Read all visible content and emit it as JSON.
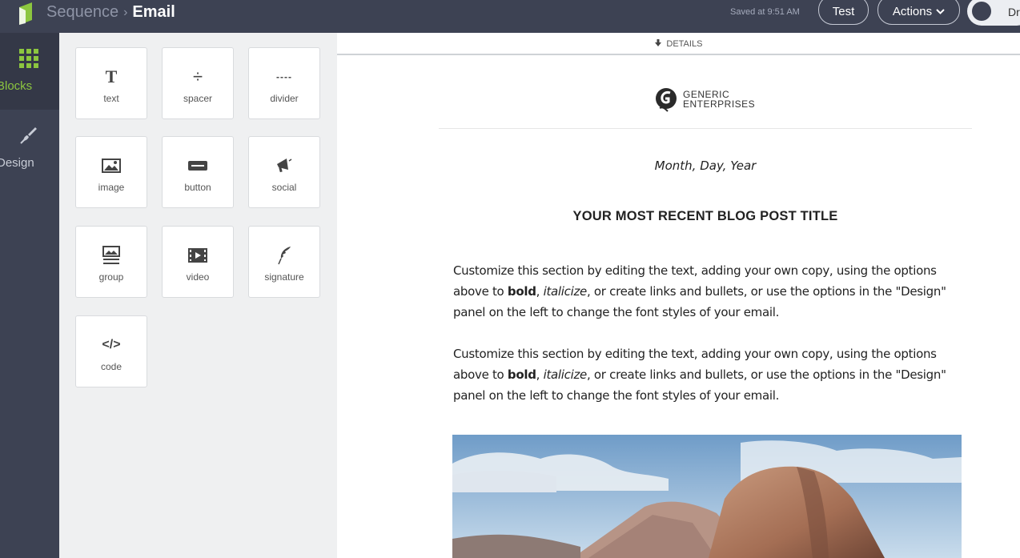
{
  "topbar": {
    "breadcrumb_parent": "Sequence",
    "breadcrumb_sep": "›",
    "breadcrumb_current": "Email",
    "saved_text": "Saved at 9:51 AM",
    "test_label": "Test",
    "actions_label": "Actions",
    "toggle_label": "Dr"
  },
  "rail": {
    "items": [
      {
        "label": "Blocks",
        "icon": "grid-icon",
        "active": true
      },
      {
        "label": "Design",
        "icon": "paintbrush-icon",
        "active": false
      }
    ]
  },
  "palette": {
    "blocks": [
      {
        "label": "text",
        "icon": "text-icon",
        "glyph": "T"
      },
      {
        "label": "spacer",
        "icon": "spacer-icon",
        "glyph": "÷"
      },
      {
        "label": "divider",
        "icon": "divider-icon",
        "glyph": "----"
      },
      {
        "label": "image",
        "icon": "image-icon"
      },
      {
        "label": "button",
        "icon": "button-icon"
      },
      {
        "label": "social",
        "icon": "megaphone-icon"
      },
      {
        "label": "group",
        "icon": "group-icon"
      },
      {
        "label": "video",
        "icon": "video-icon"
      },
      {
        "label": "signature",
        "icon": "feather-icon"
      },
      {
        "label": "code",
        "icon": "code-icon",
        "glyph": "</>"
      }
    ]
  },
  "canvas": {
    "details_label": "DETAILS",
    "brand_line1": "GENERIC",
    "brand_line2": "ENTERPRISES",
    "date": "Month, Day, Year",
    "post_title": "YOUR MOST RECENT BLOG POST TITLE",
    "paragraph": {
      "before_bold": "Customize this section by editing the text, adding your own copy, using the options above to ",
      "bold": "bold",
      "between": ", ",
      "italic": "italicize",
      "after": ", or create links and bullets, or use the options in the \"Design\" panel on the left to change the font styles of your email."
    }
  },
  "colors": {
    "topbar_bg": "#3d4253",
    "accent_green": "#8cc63f",
    "palette_bg": "#eff0f1"
  }
}
